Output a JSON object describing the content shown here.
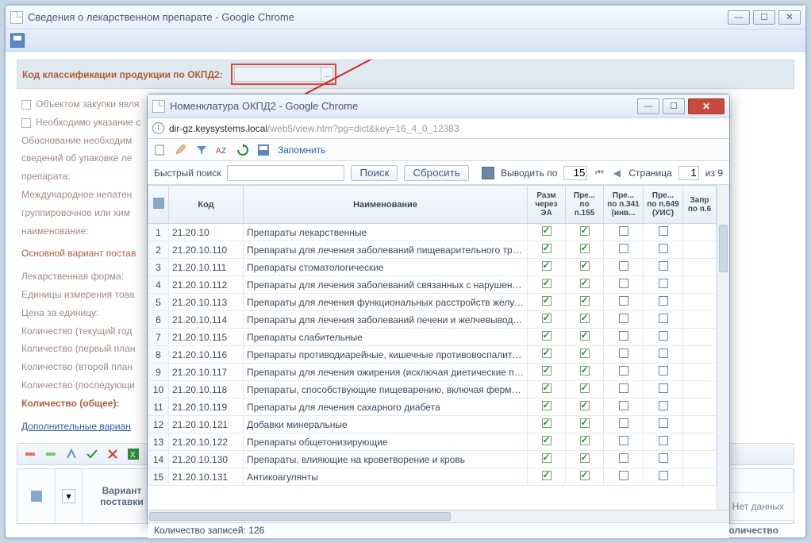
{
  "outer": {
    "title": "Сведения о лекарственном препарате - Google Chrome"
  },
  "form": {
    "okpd_label": "Код классификации продукции по ОКПД2:",
    "chk1": "Объектом закупки явля",
    "chk2": "Необходимо указание с",
    "just": "Обоснование необходим\nсведений об упаковке ле\nпрепарата:",
    "intl": "Международное непатен\nгруппировочное или хим\nнаименование:",
    "sect_main": "Основной вариант постав",
    "lek_form": "Лекарственная форма:",
    "units": "Единицы измерения това",
    "price": "Цена за единицу:",
    "qty_cur": "Количество (текущий год",
    "qty_p1": "Количество (первый план",
    "qty_p2": "Количество (второй план",
    "qty_last": "Количество (последующи",
    "qty_total": "Количество (общее):",
    "sect_add": "Дополнительные вариан",
    "vg_variant": "Вариант поставки",
    "vg_qty": "Количество товара (Всего)",
    "nodata": "Нет данных"
  },
  "modal": {
    "title": "Номенклатура ОКПД2 - Google Chrome",
    "url_host": "dir-gz.keysystems.local",
    "url_path": "/web5/view.htm?pg=dict&key=16_4_0_12383",
    "remember": "Запомнить",
    "search_label": "Быстрый поиск",
    "search_btn": "Поиск",
    "reset_btn": "Сбросить",
    "perpage_label": "Выводить по",
    "perpage_value": "15",
    "page_label": "Страница",
    "page_value": "1",
    "page_total": "из 9",
    "headers": {
      "code": "Код",
      "name": "Наименование",
      "ea": "Разм через ЭА",
      "p155": "Пре... по п.155",
      "p341": "Пре... по п.341 (инв...",
      "p649": "Пре... по п.649 (УИС)",
      "zapr": "Запр по п.6"
    },
    "rows": [
      {
        "n": "1",
        "code": "21.20.10",
        "name": "Препараты лекарственные",
        "ea": true,
        "p155": true,
        "p341": false,
        "p649": false
      },
      {
        "n": "2",
        "code": "21.20.10.110",
        "name": "Препараты для лечения заболеваний пищеварительного тракта и...",
        "ea": true,
        "p155": true,
        "p341": false,
        "p649": false
      },
      {
        "n": "3",
        "code": "21.20.10.111",
        "name": "Препараты стоматологические",
        "ea": true,
        "p155": true,
        "p341": false,
        "p649": false
      },
      {
        "n": "4",
        "code": "21.20.10.112",
        "name": "Препараты для лечения заболеваний связанных с нарушением к...",
        "ea": true,
        "p155": true,
        "p341": false,
        "p649": false
      },
      {
        "n": "5",
        "code": "21.20.10.113",
        "name": "Препараты для лечения функциональных расстройств желудочн...",
        "ea": true,
        "p155": true,
        "p341": false,
        "p649": false
      },
      {
        "n": "6",
        "code": "21.20.10.114",
        "name": "Препараты для лечения заболеваний печени и желчевыводящих ...",
        "ea": true,
        "p155": true,
        "p341": false,
        "p649": false
      },
      {
        "n": "7",
        "code": "21.20.10.115",
        "name": "Препараты слабительные",
        "ea": true,
        "p155": true,
        "p341": false,
        "p649": false
      },
      {
        "n": "8",
        "code": "21.20.10.116",
        "name": "Препараты противодиарейные, кишечные противовоспалительн...",
        "ea": true,
        "p155": true,
        "p341": false,
        "p649": false
      },
      {
        "n": "9",
        "code": "21.20.10.117",
        "name": "Препараты для лечения ожирения (исключая диетические продук...",
        "ea": true,
        "p155": true,
        "p341": false,
        "p649": false
      },
      {
        "n": "10",
        "code": "21.20.10.118",
        "name": "Препараты, способствующие пищеварению, включая ферментны...",
        "ea": true,
        "p155": true,
        "p341": false,
        "p649": false
      },
      {
        "n": "11",
        "code": "21.20.10.119",
        "name": "Препараты для лечения сахарного диабета",
        "ea": true,
        "p155": true,
        "p341": false,
        "p649": false
      },
      {
        "n": "12",
        "code": "21.20.10.121",
        "name": "Добавки минеральные",
        "ea": true,
        "p155": true,
        "p341": false,
        "p649": false
      },
      {
        "n": "13",
        "code": "21.20.10.122",
        "name": "Препараты общетонизирующие",
        "ea": true,
        "p155": true,
        "p341": false,
        "p649": false
      },
      {
        "n": "14",
        "code": "21.20.10.130",
        "name": "Препараты, влияющие на кроветворение и кровь",
        "ea": true,
        "p155": true,
        "p341": false,
        "p649": false
      },
      {
        "n": "15",
        "code": "21.20.10.131",
        "name": "Антикоагулянты",
        "ea": true,
        "p155": true,
        "p341": false,
        "p649": false
      }
    ],
    "footer": "Количество записей: 126"
  }
}
